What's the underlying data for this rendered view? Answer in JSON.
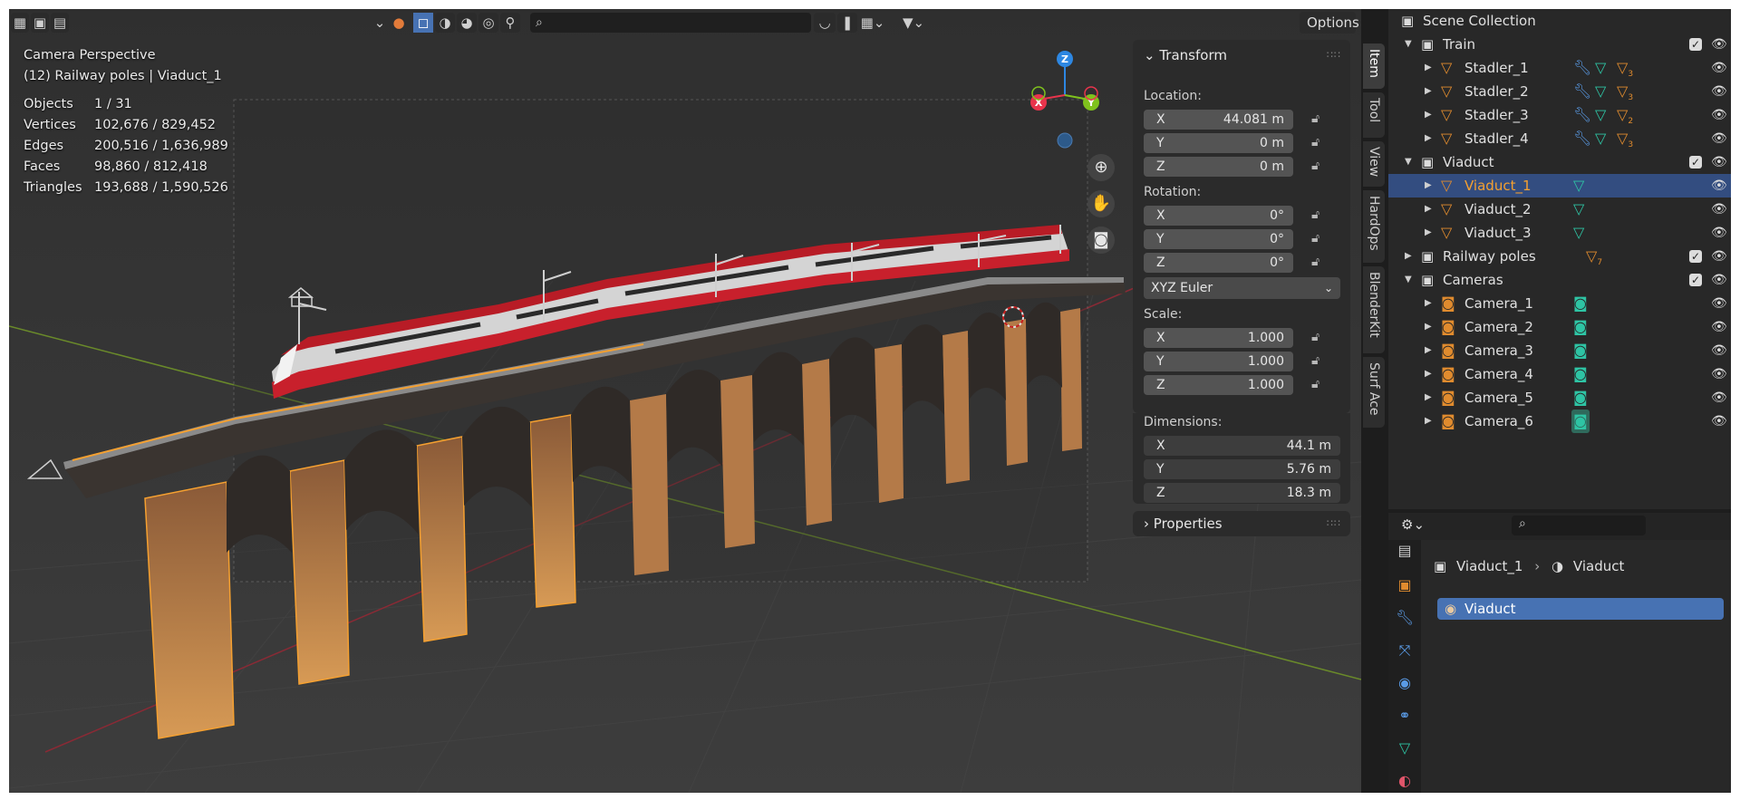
{
  "viewport": {
    "options_label": "Options",
    "overlay_title": "Camera Perspective",
    "overlay_subtitle": "(12) Railway poles | Viaduct_1",
    "stats": [
      {
        "label": "Objects",
        "value": "1 / 31"
      },
      {
        "label": "Vertices",
        "value": "102,676 / 829,452"
      },
      {
        "label": "Edges",
        "value": "200,516 / 1,636,989"
      },
      {
        "label": "Faces",
        "value": "98,860 / 812,418"
      },
      {
        "label": "Triangles",
        "value": "193,688 / 1,590,526"
      }
    ],
    "gizmo": {
      "x": "X",
      "y": "Y",
      "z": "Z",
      "x_color": "#e8344c",
      "y_color": "#7fc21d",
      "z_color": "#2d87e2"
    }
  },
  "transform_panel": {
    "title": "Transform",
    "location_label": "Location:",
    "location": [
      {
        "axis": "X",
        "value": "44.081 m"
      },
      {
        "axis": "Y",
        "value": "0 m"
      },
      {
        "axis": "Z",
        "value": "0 m"
      }
    ],
    "rotation_label": "Rotation:",
    "rotation": [
      {
        "axis": "X",
        "value": "0°"
      },
      {
        "axis": "Y",
        "value": "0°"
      },
      {
        "axis": "Z",
        "value": "0°"
      }
    ],
    "rotation_mode": "XYZ Euler",
    "scale_label": "Scale:",
    "scale": [
      {
        "axis": "X",
        "value": "1.000"
      },
      {
        "axis": "Y",
        "value": "1.000"
      },
      {
        "axis": "Z",
        "value": "1.000"
      }
    ],
    "dimensions_label": "Dimensions:",
    "dimensions": [
      {
        "axis": "X",
        "value": "44.1 m"
      },
      {
        "axis": "Y",
        "value": "5.76 m"
      },
      {
        "axis": "Z",
        "value": "18.3 m"
      }
    ],
    "properties_title": "Properties"
  },
  "side_tabs": [
    "Item",
    "Tool",
    "View",
    "HardOps",
    "BlenderKit",
    "Surf Ace"
  ],
  "outliner": {
    "scene_collection": "Scene Collection",
    "train": {
      "name": "Train",
      "children": [
        {
          "name": "Stadler_1",
          "count": "3"
        },
        {
          "name": "Stadler_2",
          "count": "3"
        },
        {
          "name": "Stadler_3",
          "count": "2"
        },
        {
          "name": "Stadler_4",
          "count": "3"
        }
      ]
    },
    "viaduct": {
      "name": "Viaduct",
      "children": [
        "Viaduct_1",
        "Viaduct_2",
        "Viaduct_3"
      ]
    },
    "railway_poles": {
      "name": "Railway poles",
      "count": "7"
    },
    "cameras": {
      "name": "Cameras",
      "children": [
        "Camera_1",
        "Camera_2",
        "Camera_3",
        "Camera_4",
        "Camera_5",
        "Camera_6"
      ]
    }
  },
  "properties": {
    "object_name": "Viaduct_1",
    "material_name": "Viaduct",
    "material_slot": "Viaduct"
  },
  "colors": {
    "selection_orange": "#f5a030",
    "accent_blue": "#4772b3",
    "selected_row": "#334d80"
  }
}
